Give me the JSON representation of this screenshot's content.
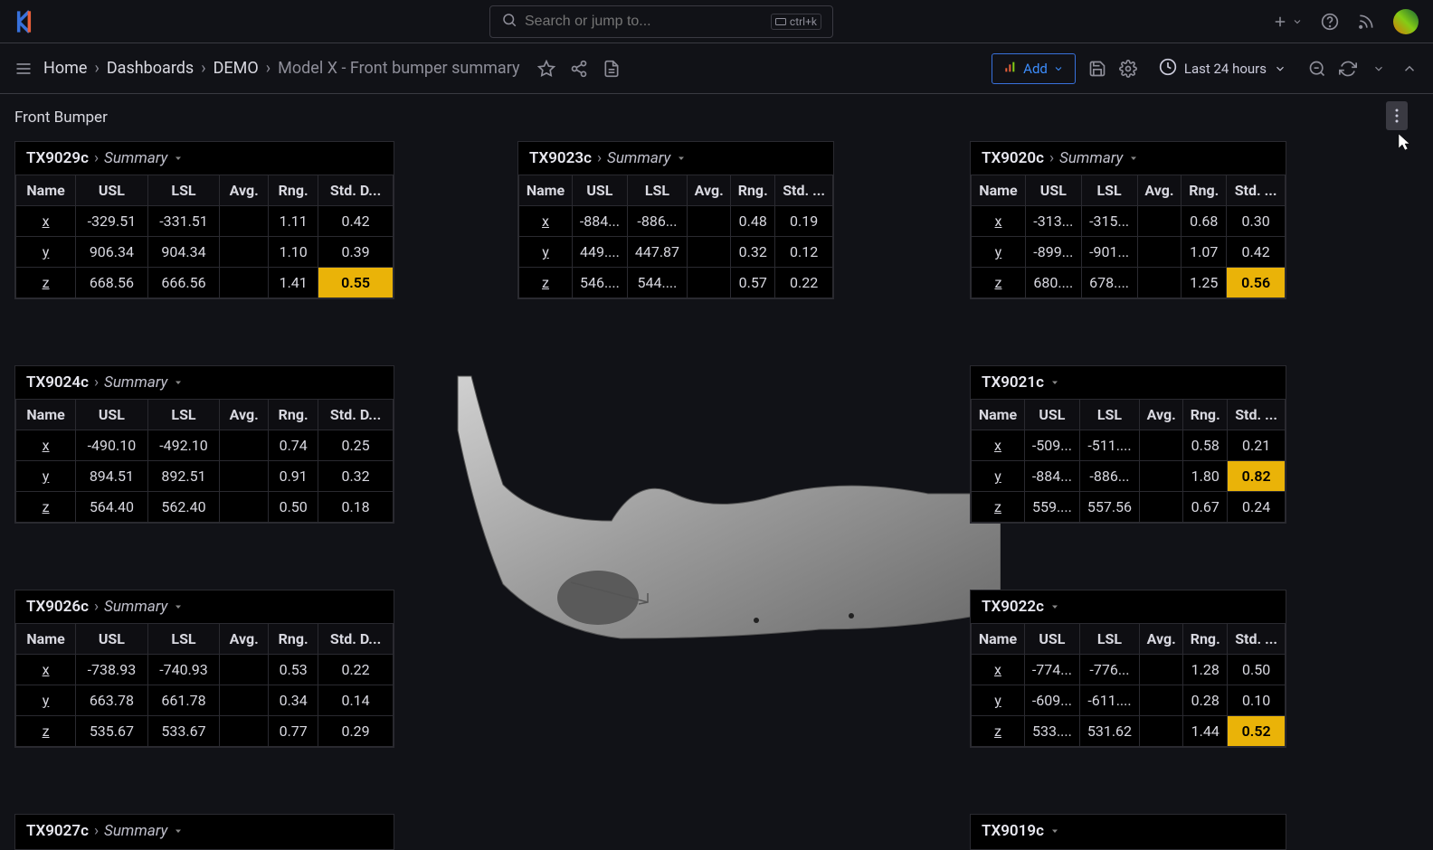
{
  "topbar": {
    "search_placeholder": "Search or jump to...",
    "shortcut": "ctrl+k"
  },
  "breadcrumb": {
    "home": "Home",
    "dashboards": "Dashboards",
    "demo": "DEMO",
    "page": "Model X - Front bumper summary"
  },
  "toolbar": {
    "add_label": "Add",
    "time_label": "Last 24 hours"
  },
  "row": {
    "title": "Front Bumper"
  },
  "columns": [
    "Name",
    "USL",
    "LSL",
    "Avg.",
    "Rng.",
    "Std. D..."
  ],
  "columns_short": [
    "Name",
    "USL",
    "LSL",
    "Avg.",
    "Rng.",
    "Std. ..."
  ],
  "panels": {
    "p1": {
      "id": "TX9029c",
      "label": "Summary",
      "rows": [
        {
          "n": "x",
          "usl": "-329.51",
          "lsl": "-331.51",
          "avg": "",
          "rng": "1.11",
          "std": "0.42",
          "hi": false
        },
        {
          "n": "y",
          "usl": "906.34",
          "lsl": "904.34",
          "avg": "",
          "rng": "1.10",
          "std": "0.39",
          "hi": false
        },
        {
          "n": "z",
          "usl": "668.56",
          "lsl": "666.56",
          "avg": "",
          "rng": "1.41",
          "std": "0.55",
          "hi": true
        }
      ]
    },
    "p2": {
      "id": "TX9023c",
      "label": "Summary",
      "rows": [
        {
          "n": "x",
          "usl": "-884...",
          "lsl": "-886...",
          "avg": "",
          "rng": "0.48",
          "std": "0.19",
          "hi": false
        },
        {
          "n": "y",
          "usl": "449....",
          "lsl": "447.87",
          "avg": "",
          "rng": "0.32",
          "std": "0.12",
          "hi": false
        },
        {
          "n": "z",
          "usl": "546....",
          "lsl": "544....",
          "avg": "",
          "rng": "0.57",
          "std": "0.22",
          "hi": false
        }
      ]
    },
    "p3": {
      "id": "TX9020c",
      "label": "Summary",
      "rows": [
        {
          "n": "x",
          "usl": "-313...",
          "lsl": "-315...",
          "avg": "",
          "rng": "0.68",
          "std": "0.30",
          "hi": false
        },
        {
          "n": "y",
          "usl": "-899...",
          "lsl": "-901...",
          "avg": "",
          "rng": "1.07",
          "std": "0.42",
          "hi": false
        },
        {
          "n": "z",
          "usl": "680....",
          "lsl": "678....",
          "avg": "",
          "rng": "1.25",
          "std": "0.56",
          "hi": true
        }
      ]
    },
    "p4": {
      "id": "TX9024c",
      "label": "Summary",
      "rows": [
        {
          "n": "x",
          "usl": "-490.10",
          "lsl": "-492.10",
          "avg": "",
          "rng": "0.74",
          "std": "0.25",
          "hi": false
        },
        {
          "n": "y",
          "usl": "894.51",
          "lsl": "892.51",
          "avg": "",
          "rng": "0.91",
          "std": "0.32",
          "hi": false
        },
        {
          "n": "z",
          "usl": "564.40",
          "lsl": "562.40",
          "avg": "",
          "rng": "0.50",
          "std": "0.18",
          "hi": false
        }
      ]
    },
    "p5": {
      "id": "TX9021c",
      "label": "",
      "rows": [
        {
          "n": "x",
          "usl": "-509...",
          "lsl": "-511....",
          "avg": "",
          "rng": "0.58",
          "std": "0.21",
          "hi": false
        },
        {
          "n": "y",
          "usl": "-884...",
          "lsl": "-886...",
          "avg": "",
          "rng": "1.80",
          "std": "0.82",
          "hi": true
        },
        {
          "n": "z",
          "usl": "559....",
          "lsl": "557.56",
          "avg": "",
          "rng": "0.67",
          "std": "0.24",
          "hi": false
        }
      ]
    },
    "p6": {
      "id": "TX9026c",
      "label": "Summary",
      "rows": [
        {
          "n": "x",
          "usl": "-738.93",
          "lsl": "-740.93",
          "avg": "",
          "rng": "0.53",
          "std": "0.22",
          "hi": false
        },
        {
          "n": "y",
          "usl": "663.78",
          "lsl": "661.78",
          "avg": "",
          "rng": "0.34",
          "std": "0.14",
          "hi": false
        },
        {
          "n": "z",
          "usl": "535.67",
          "lsl": "533.67",
          "avg": "",
          "rng": "0.77",
          "std": "0.29",
          "hi": false
        }
      ]
    },
    "p7": {
      "id": "TX9022c",
      "label": "",
      "rows": [
        {
          "n": "x",
          "usl": "-774...",
          "lsl": "-776...",
          "avg": "",
          "rng": "1.28",
          "std": "0.50",
          "hi": false
        },
        {
          "n": "y",
          "usl": "-609...",
          "lsl": "-611....",
          "avg": "",
          "rng": "0.28",
          "std": "0.10",
          "hi": false
        },
        {
          "n": "z",
          "usl": "533....",
          "lsl": "531.62",
          "avg": "",
          "rng": "1.44",
          "std": "0.52",
          "hi": true
        }
      ]
    },
    "p8": {
      "id": "TX9027c",
      "label": "Summary"
    },
    "p9": {
      "id": "TX9019c",
      "label": ""
    }
  }
}
